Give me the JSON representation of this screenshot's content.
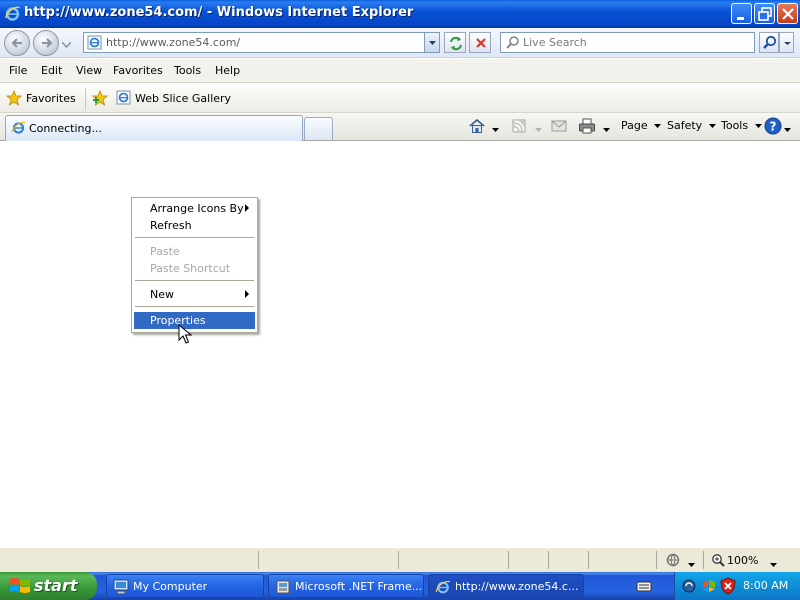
{
  "window": {
    "title": "http://www.zone54.com/ - Windows Internet Explorer"
  },
  "navigation": {
    "address": "http://www.zone54.com/",
    "search_placeholder": "Live Search"
  },
  "menubar": {
    "items": [
      "File",
      "Edit",
      "View",
      "Favorites",
      "Tools",
      "Help"
    ]
  },
  "favorites_bar": {
    "favorites_label": "Favorites",
    "web_slice_gallery": "Web Slice Gallery"
  },
  "tabs": {
    "active_tab_label": "Connecting..."
  },
  "command_bar": {
    "page": "Page",
    "safety": "Safety",
    "tools": "Tools"
  },
  "context_menu": {
    "items": [
      {
        "label": "Arrange Icons By",
        "submenu": true,
        "enabled": true
      },
      {
        "label": "Refresh",
        "submenu": false,
        "enabled": true
      },
      {
        "label": "Paste",
        "submenu": false,
        "enabled": false
      },
      {
        "label": "Paste Shortcut",
        "submenu": false,
        "enabled": false
      },
      {
        "label": "New",
        "submenu": true,
        "enabled": true
      },
      {
        "label": "Properties",
        "submenu": false,
        "enabled": true,
        "highlighted": true
      }
    ]
  },
  "status_bar": {
    "zoom": "100%"
  },
  "taskbar": {
    "start_label": "start",
    "buttons": [
      {
        "label": "My Computer"
      },
      {
        "label": "Microsoft .NET Frame..."
      },
      {
        "label": "http://www.zone54.c..."
      }
    ],
    "clock": "8:00 AM"
  },
  "colors": {
    "titlebar": "#0854d6",
    "menu_highlight": "#316ac5",
    "taskbar": "#2663e0",
    "start_button": "#379737"
  }
}
